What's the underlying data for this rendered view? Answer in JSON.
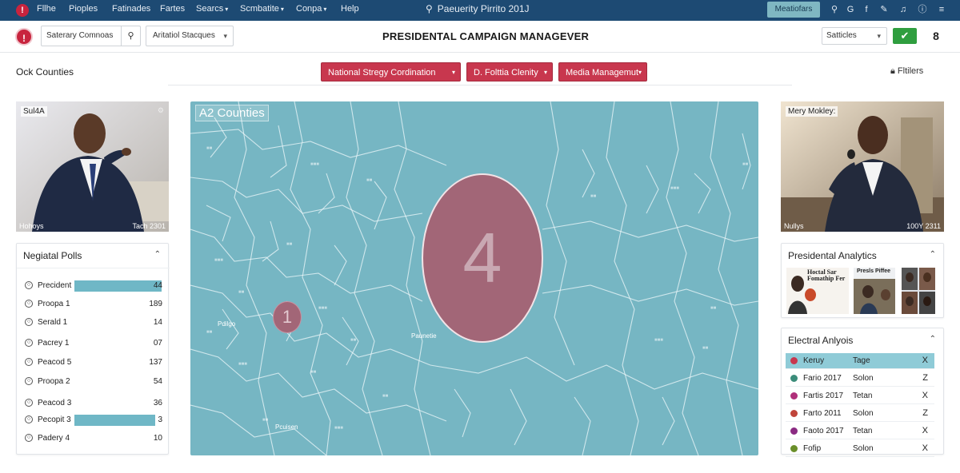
{
  "menubar": {
    "items": [
      {
        "label": "Fllhe",
        "dropdown": false
      },
      {
        "label": "Pioples",
        "dropdown": false
      },
      {
        "label": "Fatinades",
        "dropdown": false
      },
      {
        "label": "Fartes",
        "dropdown": false
      },
      {
        "label": "Searcs",
        "dropdown": true
      },
      {
        "label": "Scmbatite",
        "dropdown": true
      },
      {
        "label": "Conpa",
        "dropdown": true
      },
      {
        "label": "Help",
        "dropdown": false
      }
    ],
    "search_text": "Paeuerity Pirrito 201J",
    "highlight_button": "Meatiofars",
    "icons": [
      "search-icon",
      "google-icon",
      "facebook-icon",
      "pen-icon",
      "bell-icon",
      "info-icon",
      "menu-icon"
    ]
  },
  "toolbar": {
    "country_select": "Saterary Comnoas",
    "strategy_select": "Aritatiol Stacques",
    "title": "PRESIDENTAL CAMPAIGN MANAGEVER",
    "settings_select": "Satticles",
    "confirm_icon": "check-icon",
    "notification_count": "8"
  },
  "subheader": {
    "region_label": "Ock Counties",
    "tabs": [
      "National Stregy Cordination",
      "D. Folttia Clenity",
      "Media Managemut"
    ],
    "filters_label": "Fltilers"
  },
  "left": {
    "photo": {
      "top_caption": "Sul4A",
      "bottom_left": "Hohoys",
      "bottom_right": "Tach 2301"
    },
    "polls": {
      "title": "Negiatal Polls",
      "rows": [
        {
          "label": "Precident",
          "value": "44",
          "bar": 0.78
        },
        {
          "label": "Proopa 1",
          "value": "189",
          "bar": 0
        },
        {
          "label": "Serald 1",
          "value": "14",
          "bar": 0
        },
        {
          "label": "Pacrey 1",
          "value": "07",
          "bar": 0
        },
        {
          "label": "Peacod 5",
          "value": "137",
          "bar": 0
        },
        {
          "label": "Proopa 2",
          "value": "54",
          "bar": 0
        },
        {
          "label": "Peacod 3",
          "value": "36",
          "bar": 0
        },
        {
          "label": "Pecopit 3",
          "value": "3",
          "bar": 0.72
        },
        {
          "label": "Padery 4",
          "value": "10",
          "bar": 0
        }
      ]
    }
  },
  "map": {
    "title": "A2 Counties",
    "big_marker": "4",
    "small_marker": "1",
    "labels": [
      "Pdilgo",
      "Paunetie",
      "Pcuisen"
    ],
    "colors": {
      "sea": "#76b6c3",
      "marker": "#a26677"
    }
  },
  "right": {
    "photo": {
      "top_caption": "Mery Mokley:",
      "bottom_left": "Nullys",
      "bottom_right": "100Y 2311"
    },
    "analytics": {
      "title": "Presidental Analytics",
      "thumb_texts": [
        "Hoctal Sar Fomathip Fer",
        "Presls Piffee"
      ]
    },
    "electoral": {
      "title": "Electral Anlyois",
      "header": {
        "name": "Keruy",
        "type": "Tage",
        "x": "X"
      },
      "rows": [
        {
          "name": "Fario 2017",
          "type": "Solon",
          "x": "Z",
          "color": "#3b8c7a"
        },
        {
          "name": "Fartis 2017",
          "type": "Tetan",
          "x": "X",
          "color": "#b0307a"
        },
        {
          "name": "Farto 2011",
          "type": "Solon",
          "x": "Z",
          "color": "#c0443a"
        },
        {
          "name": "Faoto 2017",
          "type": "Tetan",
          "x": "X",
          "color": "#8a2a82"
        },
        {
          "name": "Fofip",
          "type": "Solon",
          "x": "X",
          "color": "#6a8f2a"
        }
      ]
    }
  }
}
